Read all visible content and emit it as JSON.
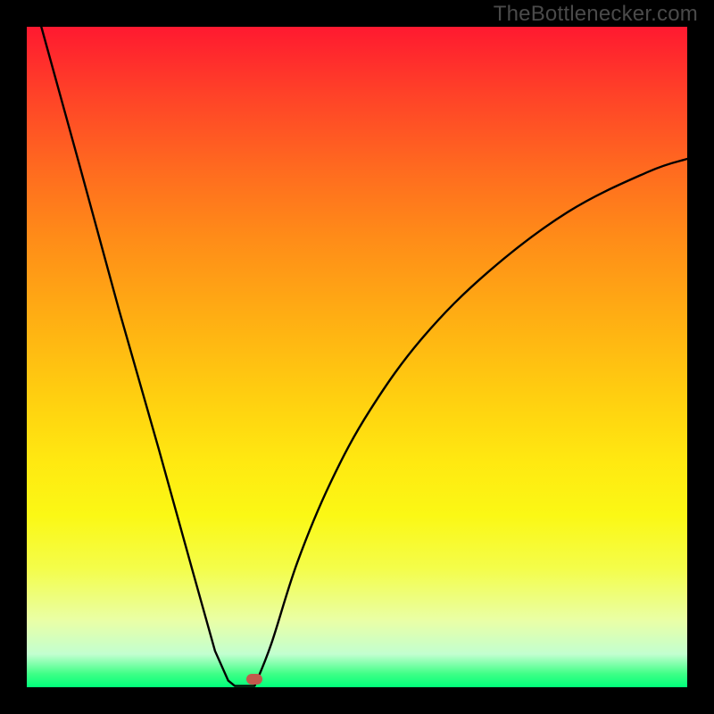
{
  "watermark": "TheBottlenecker.com",
  "chart_data": {
    "type": "line",
    "title": "",
    "xlabel": "",
    "ylabel": "",
    "xlim": [
      0,
      1
    ],
    "ylim": [
      0,
      1
    ],
    "series": [
      {
        "name": "curve",
        "x": [
          0.022,
          0.08,
          0.14,
          0.2,
          0.25,
          0.285,
          0.305,
          0.315,
          0.325,
          0.335,
          0.345
        ],
        "y": [
          1.0,
          0.79,
          0.57,
          0.36,
          0.18,
          0.055,
          0.01,
          0.002,
          0.002,
          0.002,
          0.002
        ]
      },
      {
        "name": "curve-right",
        "x": [
          0.345,
          0.37,
          0.41,
          0.46,
          0.52,
          0.6,
          0.7,
          0.82,
          0.94,
          1.0
        ],
        "y": [
          0.002,
          0.065,
          0.19,
          0.31,
          0.42,
          0.53,
          0.63,
          0.72,
          0.78,
          0.8
        ]
      }
    ],
    "marker": {
      "x": 0.345,
      "y": 0.012
    },
    "colors": {
      "curve": "#000000",
      "marker": "#c1594c",
      "frame": "#000000"
    }
  }
}
